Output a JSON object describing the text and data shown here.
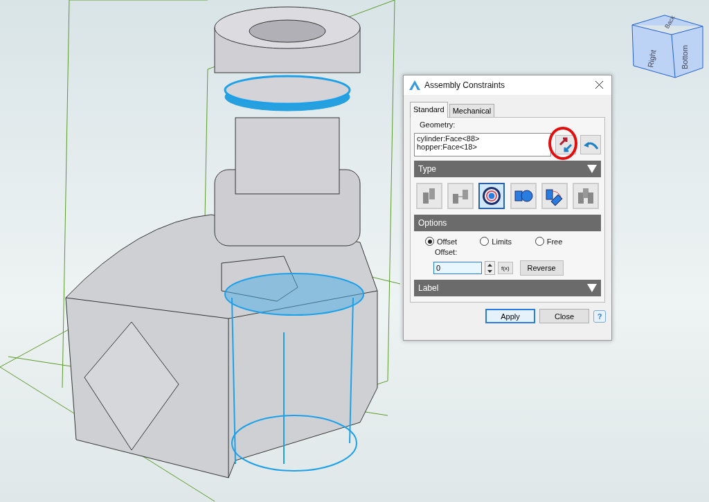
{
  "view_cube": {
    "faces": [
      {
        "kind": "top",
        "label": "Back"
      },
      {
        "kind": "front",
        "label": "Right"
      },
      {
        "kind": "side",
        "label": "Bottom"
      }
    ]
  },
  "dialog": {
    "title": "Assembly Constraints",
    "tabs": [
      {
        "label": "Standard",
        "selected": true
      },
      {
        "label": "Mechanical",
        "selected": false
      }
    ],
    "geometry": {
      "label": "Geometry:",
      "items": [
        "cylinder:Face<88>",
        "hopper:Face<18>"
      ],
      "swap_highlighted": true
    },
    "type_section": {
      "header": "Type",
      "toggle": true
    },
    "constraint_types": [
      {
        "kind": "coincident",
        "selected": false
      },
      {
        "kind": "distance",
        "selected": false
      },
      {
        "kind": "concentric",
        "selected": true
      },
      {
        "kind": "tangent",
        "selected": false
      },
      {
        "kind": "angle",
        "selected": false
      },
      {
        "kind": "symmetric",
        "selected": false
      }
    ],
    "options_section": {
      "header": "Options",
      "toggle": false
    },
    "modes": [
      {
        "label": "Offset",
        "selected": true
      },
      {
        "label": "Limits",
        "selected": false
      },
      {
        "label": "Free",
        "selected": false
      }
    ],
    "offset": {
      "label": "Offset:",
      "value": "0",
      "fx": "f(x)",
      "reverse": "Reverse"
    },
    "label_section": {
      "header": "Label",
      "toggle": true
    },
    "buttons": [
      {
        "label": "Apply",
        "default": true
      },
      {
        "label": "Close",
        "default": false
      }
    ],
    "help": "?"
  }
}
